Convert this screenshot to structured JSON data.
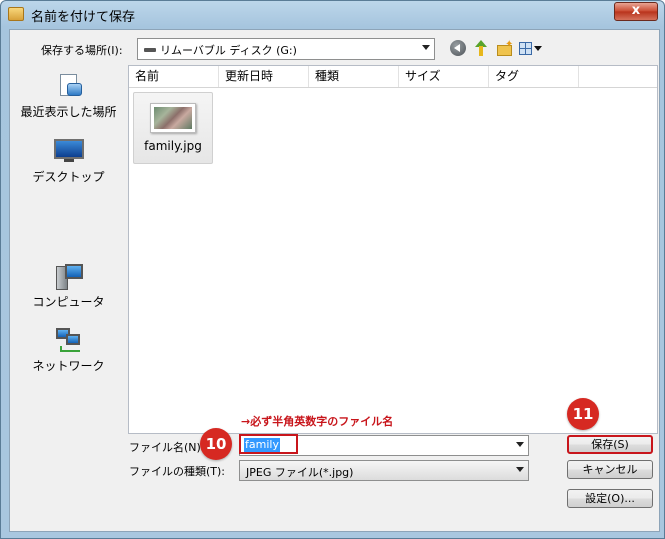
{
  "window": {
    "title": "名前を付けて保存",
    "close_label": "x"
  },
  "toolbar": {
    "look_in_label": "保存する場所(I):",
    "look_in_value": "リムーバブル ディスク (G:)"
  },
  "places": [
    {
      "label": "最近表示した場所",
      "icon": "recent-places-icon"
    },
    {
      "label": "デスクトップ",
      "icon": "desktop-icon"
    },
    {
      "label": "コンピュータ",
      "icon": "computer-icon"
    },
    {
      "label": "ネットワーク",
      "icon": "network-icon"
    }
  ],
  "file_list": {
    "columns": [
      "名前",
      "更新日時",
      "種類",
      "サイズ",
      "タグ"
    ],
    "items": [
      {
        "name": "family.jpg",
        "icon": "jpeg-thumbnail-icon"
      }
    ]
  },
  "annotation": {
    "text": "→必ず半角英数字のファイル名",
    "color": "#c8151b"
  },
  "form": {
    "file_name_label": "ファイル名(N):",
    "file_name_value": "family",
    "file_type_label": "ファイルの種類(T):",
    "file_type_value": "JPEG ファイル(*.jpg)"
  },
  "buttons": {
    "save": "保存(S)",
    "cancel": "キャンセル",
    "settings": "設定(O)..."
  },
  "badges": {
    "step10": "10",
    "step11": "11"
  }
}
